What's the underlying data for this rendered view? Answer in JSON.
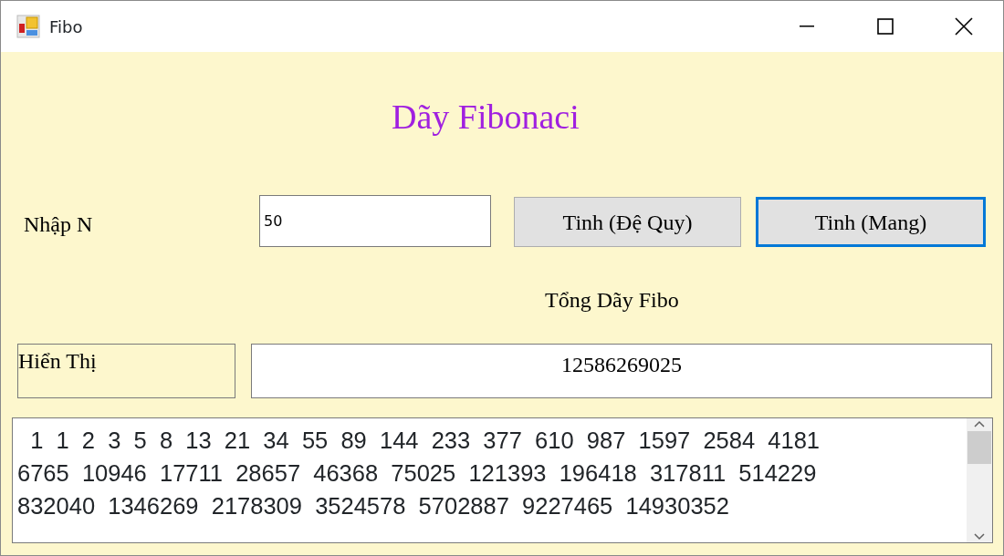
{
  "window": {
    "title": "Fibo"
  },
  "heading": "Dãy Fibonaci",
  "input_label": "Nhập N",
  "n_field": {
    "value": "50"
  },
  "buttons": [
    {
      "label": "Tinh (Đệ Quy)",
      "focused": false
    },
    {
      "label": "Tinh (Mang)",
      "focused": true
    }
  ],
  "sum_label": "Tổng Dãy Fibo",
  "display_label": "Hiển Thị",
  "sum_value": "12586269025",
  "output": {
    "lines": [
      "  1  1  2  3  5  8  13  21  34  55  89  144  233  377  610  987  1597  2584  4181",
      "6765  10946  17711  28657  46368  75025  121393  196418  317811  514229",
      "832040  1346269  2178309  3524578  5702887  9227465  14930352"
    ]
  }
}
